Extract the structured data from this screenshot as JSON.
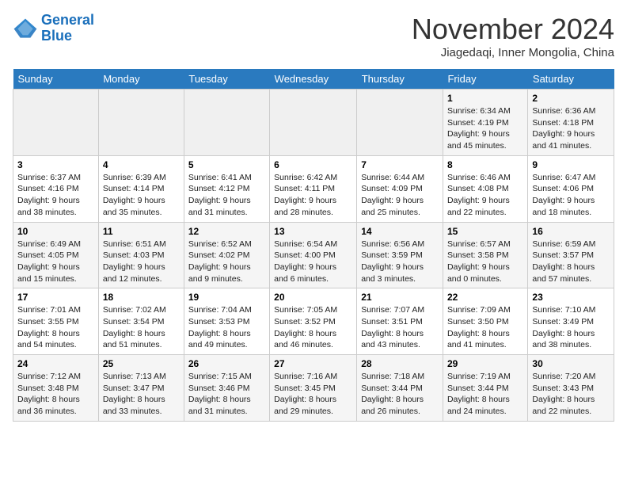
{
  "app": {
    "logo_line1": "General",
    "logo_line2": "Blue"
  },
  "header": {
    "month_title": "November 2024",
    "location": "Jiagedaqi, Inner Mongolia, China"
  },
  "days_of_week": [
    "Sunday",
    "Monday",
    "Tuesday",
    "Wednesday",
    "Thursday",
    "Friday",
    "Saturday"
  ],
  "weeks": [
    [
      {
        "day": "",
        "info": ""
      },
      {
        "day": "",
        "info": ""
      },
      {
        "day": "",
        "info": ""
      },
      {
        "day": "",
        "info": ""
      },
      {
        "day": "",
        "info": ""
      },
      {
        "day": "1",
        "info": "Sunrise: 6:34 AM\nSunset: 4:19 PM\nDaylight: 9 hours and 45 minutes."
      },
      {
        "day": "2",
        "info": "Sunrise: 6:36 AM\nSunset: 4:18 PM\nDaylight: 9 hours and 41 minutes."
      }
    ],
    [
      {
        "day": "3",
        "info": "Sunrise: 6:37 AM\nSunset: 4:16 PM\nDaylight: 9 hours and 38 minutes."
      },
      {
        "day": "4",
        "info": "Sunrise: 6:39 AM\nSunset: 4:14 PM\nDaylight: 9 hours and 35 minutes."
      },
      {
        "day": "5",
        "info": "Sunrise: 6:41 AM\nSunset: 4:12 PM\nDaylight: 9 hours and 31 minutes."
      },
      {
        "day": "6",
        "info": "Sunrise: 6:42 AM\nSunset: 4:11 PM\nDaylight: 9 hours and 28 minutes."
      },
      {
        "day": "7",
        "info": "Sunrise: 6:44 AM\nSunset: 4:09 PM\nDaylight: 9 hours and 25 minutes."
      },
      {
        "day": "8",
        "info": "Sunrise: 6:46 AM\nSunset: 4:08 PM\nDaylight: 9 hours and 22 minutes."
      },
      {
        "day": "9",
        "info": "Sunrise: 6:47 AM\nSunset: 4:06 PM\nDaylight: 9 hours and 18 minutes."
      }
    ],
    [
      {
        "day": "10",
        "info": "Sunrise: 6:49 AM\nSunset: 4:05 PM\nDaylight: 9 hours and 15 minutes."
      },
      {
        "day": "11",
        "info": "Sunrise: 6:51 AM\nSunset: 4:03 PM\nDaylight: 9 hours and 12 minutes."
      },
      {
        "day": "12",
        "info": "Sunrise: 6:52 AM\nSunset: 4:02 PM\nDaylight: 9 hours and 9 minutes."
      },
      {
        "day": "13",
        "info": "Sunrise: 6:54 AM\nSunset: 4:00 PM\nDaylight: 9 hours and 6 minutes."
      },
      {
        "day": "14",
        "info": "Sunrise: 6:56 AM\nSunset: 3:59 PM\nDaylight: 9 hours and 3 minutes."
      },
      {
        "day": "15",
        "info": "Sunrise: 6:57 AM\nSunset: 3:58 PM\nDaylight: 9 hours and 0 minutes."
      },
      {
        "day": "16",
        "info": "Sunrise: 6:59 AM\nSunset: 3:57 PM\nDaylight: 8 hours and 57 minutes."
      }
    ],
    [
      {
        "day": "17",
        "info": "Sunrise: 7:01 AM\nSunset: 3:55 PM\nDaylight: 8 hours and 54 minutes."
      },
      {
        "day": "18",
        "info": "Sunrise: 7:02 AM\nSunset: 3:54 PM\nDaylight: 8 hours and 51 minutes."
      },
      {
        "day": "19",
        "info": "Sunrise: 7:04 AM\nSunset: 3:53 PM\nDaylight: 8 hours and 49 minutes."
      },
      {
        "day": "20",
        "info": "Sunrise: 7:05 AM\nSunset: 3:52 PM\nDaylight: 8 hours and 46 minutes."
      },
      {
        "day": "21",
        "info": "Sunrise: 7:07 AM\nSunset: 3:51 PM\nDaylight: 8 hours and 43 minutes."
      },
      {
        "day": "22",
        "info": "Sunrise: 7:09 AM\nSunset: 3:50 PM\nDaylight: 8 hours and 41 minutes."
      },
      {
        "day": "23",
        "info": "Sunrise: 7:10 AM\nSunset: 3:49 PM\nDaylight: 8 hours and 38 minutes."
      }
    ],
    [
      {
        "day": "24",
        "info": "Sunrise: 7:12 AM\nSunset: 3:48 PM\nDaylight: 8 hours and 36 minutes."
      },
      {
        "day": "25",
        "info": "Sunrise: 7:13 AM\nSunset: 3:47 PM\nDaylight: 8 hours and 33 minutes."
      },
      {
        "day": "26",
        "info": "Sunrise: 7:15 AM\nSunset: 3:46 PM\nDaylight: 8 hours and 31 minutes."
      },
      {
        "day": "27",
        "info": "Sunrise: 7:16 AM\nSunset: 3:45 PM\nDaylight: 8 hours and 29 minutes."
      },
      {
        "day": "28",
        "info": "Sunrise: 7:18 AM\nSunset: 3:44 PM\nDaylight: 8 hours and 26 minutes."
      },
      {
        "day": "29",
        "info": "Sunrise: 7:19 AM\nSunset: 3:44 PM\nDaylight: 8 hours and 24 minutes."
      },
      {
        "day": "30",
        "info": "Sunrise: 7:20 AM\nSunset: 3:43 PM\nDaylight: 8 hours and 22 minutes."
      }
    ]
  ]
}
